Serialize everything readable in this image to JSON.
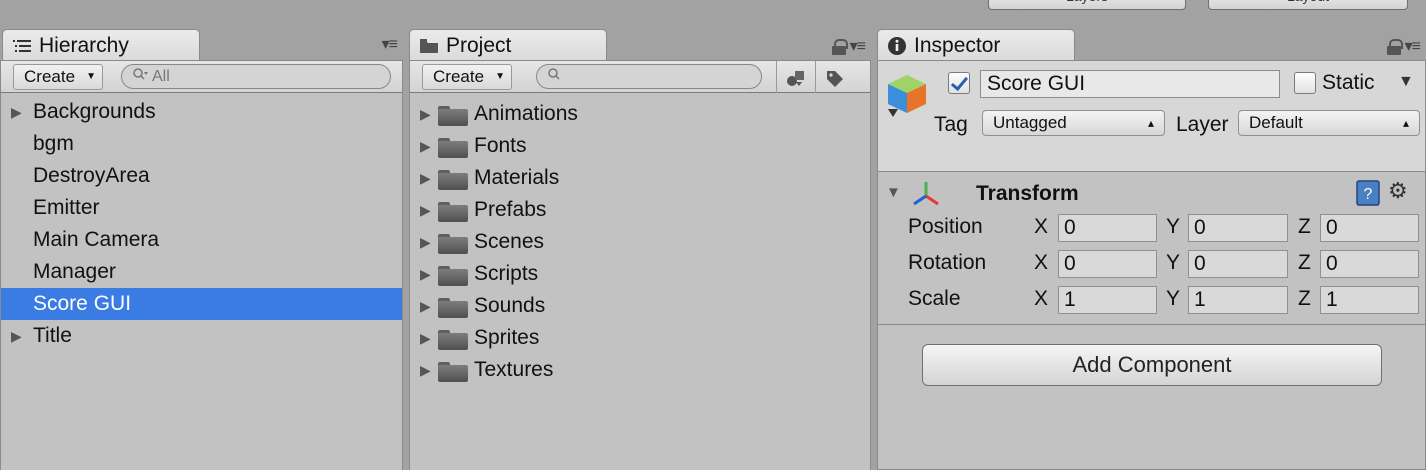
{
  "toolbar_top": {
    "layers_label": "Layers",
    "layout_label": "Layout"
  },
  "hierarchy": {
    "tab_label": "Hierarchy",
    "create_label": "Create",
    "search_placeholder": "All",
    "items": [
      {
        "label": "Backgrounds",
        "expandable": true,
        "selected": false
      },
      {
        "label": "bgm",
        "expandable": false,
        "selected": false
      },
      {
        "label": "DestroyArea",
        "expandable": false,
        "selected": false
      },
      {
        "label": "Emitter",
        "expandable": false,
        "selected": false
      },
      {
        "label": "Main Camera",
        "expandable": false,
        "selected": false
      },
      {
        "label": "Manager",
        "expandable": false,
        "selected": false
      },
      {
        "label": "Score GUI",
        "expandable": false,
        "selected": true
      },
      {
        "label": "Title",
        "expandable": true,
        "selected": false
      }
    ]
  },
  "project": {
    "tab_label": "Project",
    "create_label": "Create",
    "search_value": "",
    "folders": [
      "Animations",
      "Fonts",
      "Materials",
      "Prefabs",
      "Scenes",
      "Scripts",
      "Sounds",
      "Sprites",
      "Textures"
    ]
  },
  "inspector": {
    "tab_label": "Inspector",
    "object_name": "Score GUI",
    "active": true,
    "static_label": "Static",
    "static_checked": false,
    "tag_label": "Tag",
    "tag_value": "Untagged",
    "layer_label": "Layer",
    "layer_value": "Default",
    "transform": {
      "title": "Transform",
      "rows": [
        {
          "label": "Position",
          "x": "0",
          "y": "0",
          "z": "0"
        },
        {
          "label": "Rotation",
          "x": "0",
          "y": "0",
          "z": "0"
        },
        {
          "label": "Scale",
          "x": "1",
          "y": "1",
          "z": "1"
        }
      ],
      "axis_x": "X",
      "axis_y": "Y",
      "axis_z": "Z"
    },
    "add_component_label": "Add Component"
  },
  "colors": {
    "selection": "#3a7be4",
    "panel_bg": "#c2c2c2",
    "window_bg": "#a2a2a2"
  }
}
